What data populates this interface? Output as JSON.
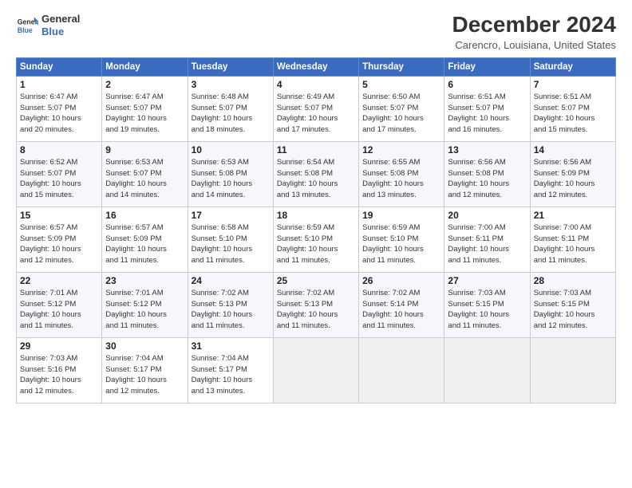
{
  "logo": {
    "line1": "General",
    "line2": "Blue"
  },
  "title": "December 2024",
  "subtitle": "Carencro, Louisiana, United States",
  "headers": [
    "Sunday",
    "Monday",
    "Tuesday",
    "Wednesday",
    "Thursday",
    "Friday",
    "Saturday"
  ],
  "weeks": [
    [
      {
        "day": "1",
        "info": "Sunrise: 6:47 AM\nSunset: 5:07 PM\nDaylight: 10 hours\nand 20 minutes."
      },
      {
        "day": "2",
        "info": "Sunrise: 6:47 AM\nSunset: 5:07 PM\nDaylight: 10 hours\nand 19 minutes."
      },
      {
        "day": "3",
        "info": "Sunrise: 6:48 AM\nSunset: 5:07 PM\nDaylight: 10 hours\nand 18 minutes."
      },
      {
        "day": "4",
        "info": "Sunrise: 6:49 AM\nSunset: 5:07 PM\nDaylight: 10 hours\nand 17 minutes."
      },
      {
        "day": "5",
        "info": "Sunrise: 6:50 AM\nSunset: 5:07 PM\nDaylight: 10 hours\nand 17 minutes."
      },
      {
        "day": "6",
        "info": "Sunrise: 6:51 AM\nSunset: 5:07 PM\nDaylight: 10 hours\nand 16 minutes."
      },
      {
        "day": "7",
        "info": "Sunrise: 6:51 AM\nSunset: 5:07 PM\nDaylight: 10 hours\nand 15 minutes."
      }
    ],
    [
      {
        "day": "8",
        "info": "Sunrise: 6:52 AM\nSunset: 5:07 PM\nDaylight: 10 hours\nand 15 minutes."
      },
      {
        "day": "9",
        "info": "Sunrise: 6:53 AM\nSunset: 5:07 PM\nDaylight: 10 hours\nand 14 minutes."
      },
      {
        "day": "10",
        "info": "Sunrise: 6:53 AM\nSunset: 5:08 PM\nDaylight: 10 hours\nand 14 minutes."
      },
      {
        "day": "11",
        "info": "Sunrise: 6:54 AM\nSunset: 5:08 PM\nDaylight: 10 hours\nand 13 minutes."
      },
      {
        "day": "12",
        "info": "Sunrise: 6:55 AM\nSunset: 5:08 PM\nDaylight: 10 hours\nand 13 minutes."
      },
      {
        "day": "13",
        "info": "Sunrise: 6:56 AM\nSunset: 5:08 PM\nDaylight: 10 hours\nand 12 minutes."
      },
      {
        "day": "14",
        "info": "Sunrise: 6:56 AM\nSunset: 5:09 PM\nDaylight: 10 hours\nand 12 minutes."
      }
    ],
    [
      {
        "day": "15",
        "info": "Sunrise: 6:57 AM\nSunset: 5:09 PM\nDaylight: 10 hours\nand 12 minutes."
      },
      {
        "day": "16",
        "info": "Sunrise: 6:57 AM\nSunset: 5:09 PM\nDaylight: 10 hours\nand 11 minutes."
      },
      {
        "day": "17",
        "info": "Sunrise: 6:58 AM\nSunset: 5:10 PM\nDaylight: 10 hours\nand 11 minutes."
      },
      {
        "day": "18",
        "info": "Sunrise: 6:59 AM\nSunset: 5:10 PM\nDaylight: 10 hours\nand 11 minutes."
      },
      {
        "day": "19",
        "info": "Sunrise: 6:59 AM\nSunset: 5:10 PM\nDaylight: 10 hours\nand 11 minutes."
      },
      {
        "day": "20",
        "info": "Sunrise: 7:00 AM\nSunset: 5:11 PM\nDaylight: 10 hours\nand 11 minutes."
      },
      {
        "day": "21",
        "info": "Sunrise: 7:00 AM\nSunset: 5:11 PM\nDaylight: 10 hours\nand 11 minutes."
      }
    ],
    [
      {
        "day": "22",
        "info": "Sunrise: 7:01 AM\nSunset: 5:12 PM\nDaylight: 10 hours\nand 11 minutes."
      },
      {
        "day": "23",
        "info": "Sunrise: 7:01 AM\nSunset: 5:12 PM\nDaylight: 10 hours\nand 11 minutes."
      },
      {
        "day": "24",
        "info": "Sunrise: 7:02 AM\nSunset: 5:13 PM\nDaylight: 10 hours\nand 11 minutes."
      },
      {
        "day": "25",
        "info": "Sunrise: 7:02 AM\nSunset: 5:13 PM\nDaylight: 10 hours\nand 11 minutes."
      },
      {
        "day": "26",
        "info": "Sunrise: 7:02 AM\nSunset: 5:14 PM\nDaylight: 10 hours\nand 11 minutes."
      },
      {
        "day": "27",
        "info": "Sunrise: 7:03 AM\nSunset: 5:15 PM\nDaylight: 10 hours\nand 11 minutes."
      },
      {
        "day": "28",
        "info": "Sunrise: 7:03 AM\nSunset: 5:15 PM\nDaylight: 10 hours\nand 12 minutes."
      }
    ],
    [
      {
        "day": "29",
        "info": "Sunrise: 7:03 AM\nSunset: 5:16 PM\nDaylight: 10 hours\nand 12 minutes."
      },
      {
        "day": "30",
        "info": "Sunrise: 7:04 AM\nSunset: 5:17 PM\nDaylight: 10 hours\nand 12 minutes."
      },
      {
        "day": "31",
        "info": "Sunrise: 7:04 AM\nSunset: 5:17 PM\nDaylight: 10 hours\nand 13 minutes."
      },
      {
        "day": "",
        "info": ""
      },
      {
        "day": "",
        "info": ""
      },
      {
        "day": "",
        "info": ""
      },
      {
        "day": "",
        "info": ""
      }
    ]
  ]
}
